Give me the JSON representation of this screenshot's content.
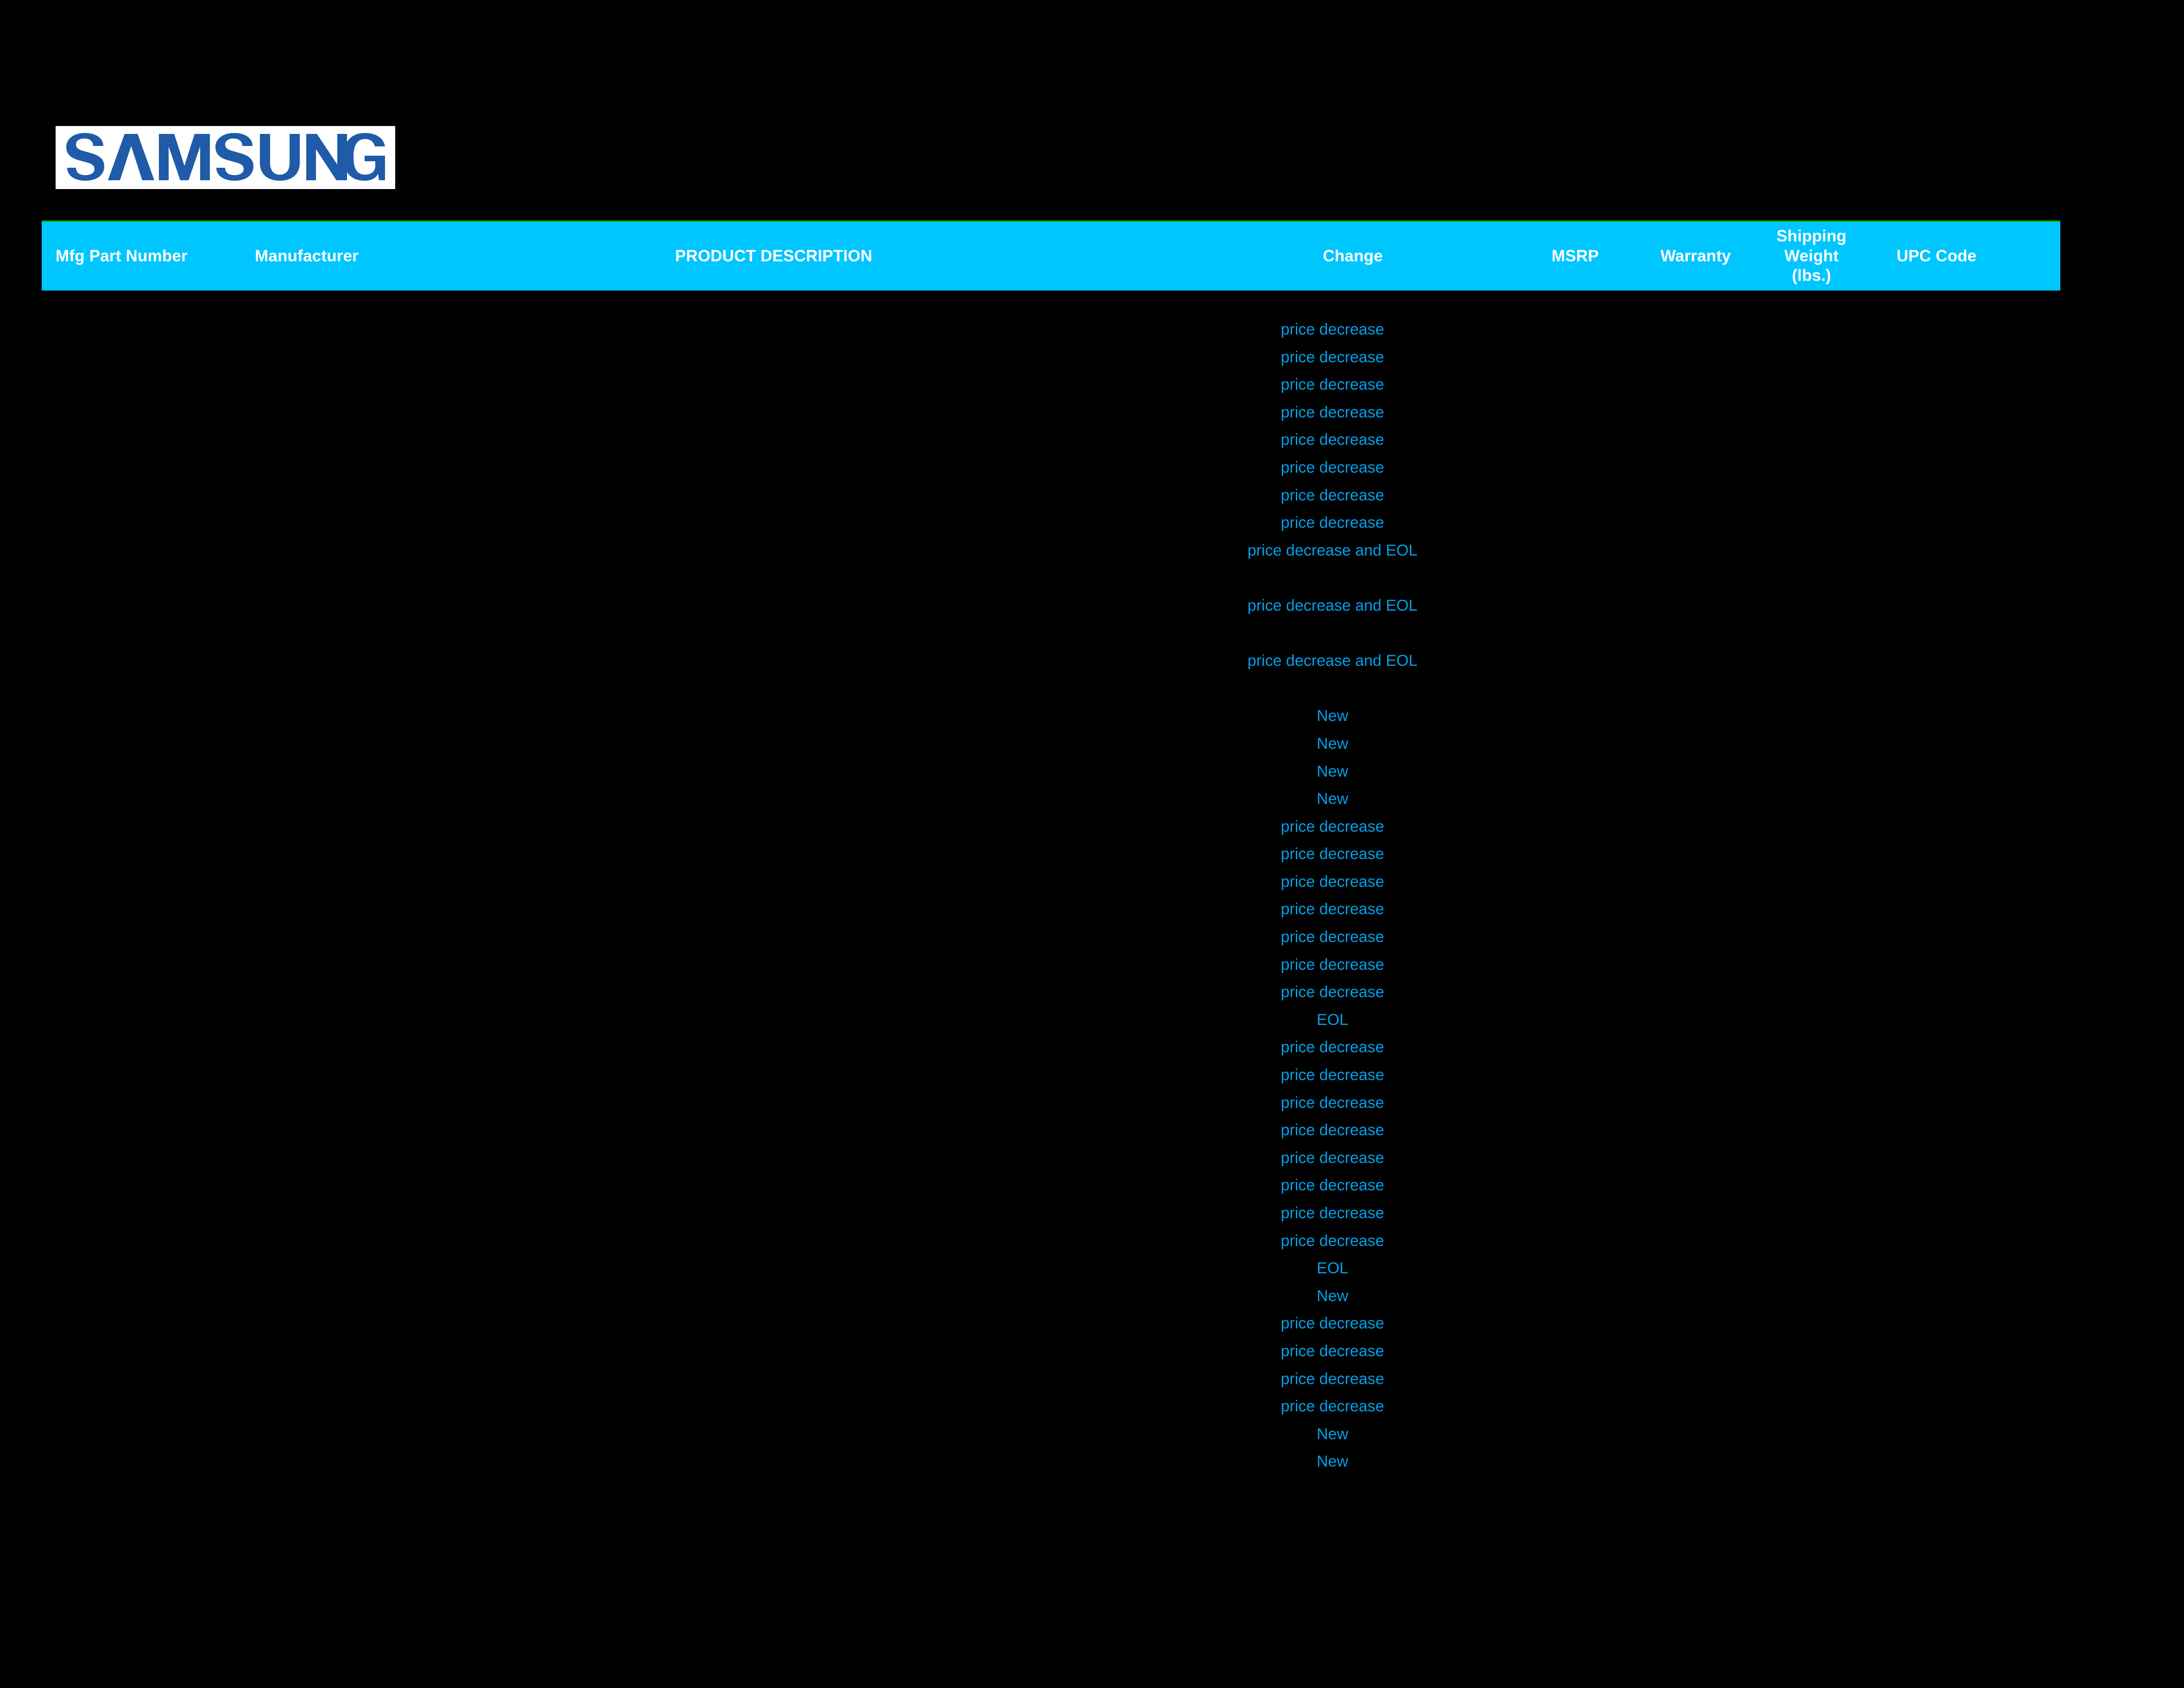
{
  "brand": {
    "logo_name": "SAMSUNG",
    "logo_text_color": "#1f5ba8",
    "logo_bg_color": "#ffffff"
  },
  "colors": {
    "page_background": "#000000",
    "header_background": "#00c6ff",
    "header_text": "#ffffff",
    "header_top_rule": "#00c000",
    "body_text": "#00a0e8"
  },
  "table": {
    "columns": [
      {
        "key": "mfg_part_number",
        "label": "Mfg Part Number"
      },
      {
        "key": "manufacturer",
        "label": "Manufacturer"
      },
      {
        "key": "product_description",
        "label": "PRODUCT DESCRIPTION"
      },
      {
        "key": "change",
        "label": "Change"
      },
      {
        "key": "msrp",
        "label": "MSRP"
      },
      {
        "key": "warranty",
        "label": "Warranty"
      },
      {
        "key": "shipping_weight",
        "label": "Shipping\nWeight\n(lbs.)"
      },
      {
        "key": "upc_code",
        "label": "UPC Code"
      }
    ],
    "change_values": [
      "price decrease",
      "price decrease",
      "price decrease",
      "price decrease",
      "price decrease",
      "price decrease",
      "price decrease",
      "price decrease",
      "price decrease and EOL",
      "",
      "price decrease and EOL",
      "",
      "price decrease and EOL",
      "",
      "New",
      "New",
      "New",
      "New",
      "price decrease",
      "price decrease",
      "price decrease",
      "price decrease",
      "price decrease",
      "price decrease",
      "price decrease",
      "EOL",
      "price decrease",
      "price decrease",
      "price decrease",
      "price decrease",
      "price decrease",
      "price decrease",
      "price decrease",
      "price decrease",
      "EOL",
      "New",
      "price decrease",
      "price decrease",
      "price decrease",
      "price decrease",
      "New",
      "New"
    ]
  }
}
